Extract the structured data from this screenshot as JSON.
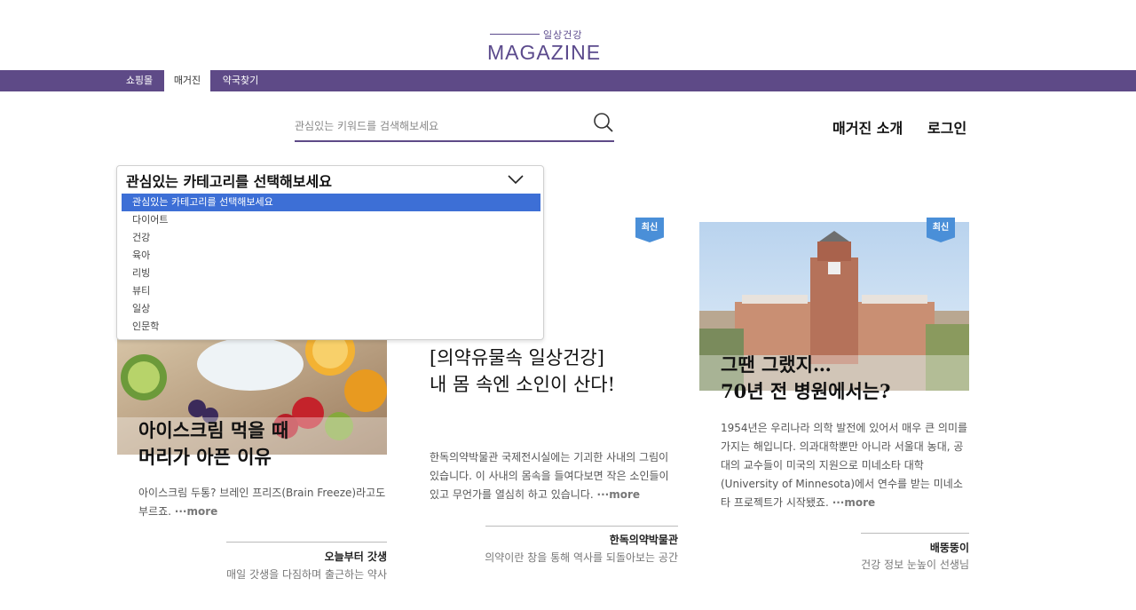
{
  "logo": {
    "sub": "일상건강",
    "main": "MAGAZINE"
  },
  "nav": [
    {
      "label": "쇼핑몰"
    },
    {
      "label": "매거진"
    },
    {
      "label": "약국찾기"
    }
  ],
  "search": {
    "placeholder": "관심있는 키워드를 검색해보세요",
    "value": ""
  },
  "header_links": {
    "about": "매거진 소개",
    "login": "로그인"
  },
  "category_select": {
    "selected": "관심있는 카테고리를 선택해보세요",
    "options": [
      "관심있는 카테고리를 선택해보세요",
      "다이어트",
      "건강",
      "육아",
      "리빙",
      "뷰티",
      "일상",
      "인문학"
    ]
  },
  "cards": [
    {
      "title_line1": "아이스크림 먹을 때",
      "title_line2": "머리가 아픈 이유",
      "desc": "아이스크림 두통? 브레인 프리즈(Brain Freeze)라고도 부르죠.",
      "more": "···more",
      "author": "오늘부터 갓생",
      "author_sub": "매일 갓생을 다짐하며 출근하는 약사"
    },
    {
      "badge": "최신",
      "title_line1": "[의약유물속 일상건강]",
      "title_line2": "내 몸 속엔 소인이 산다!",
      "desc": "한독의약박물관 국제전시실에는 기괴한 사내의 그림이 있습니다. 이 사내의 몸속을 들여다보면 작은 소인들이 있고 무언가를 열심히 하고 있습니다.",
      "more": "···more",
      "author": "한독의약박물관",
      "author_sub": "의약이란 창을 통해 역사를 되돌아보는 공간"
    },
    {
      "badge": "최신",
      "title_line1": "그땐 그랬지…",
      "title_line2": "70년 전 병원에서는?",
      "desc": "1954년은 우리나라 의학 발전에 있어서 매우 큰 의미를 가지는 해입니다. 의과대학뿐만 아니라 서울대 농대, 공대의 교수들이 미국의 지원으로 미네소타 대학(University of Minnesota)에서 연수를 받는 미네소타 프로젝트가 시작됐죠.",
      "more": "···more",
      "author": "배뚱뚱이",
      "author_sub": "건강 정보 눈높이 선생님"
    }
  ]
}
